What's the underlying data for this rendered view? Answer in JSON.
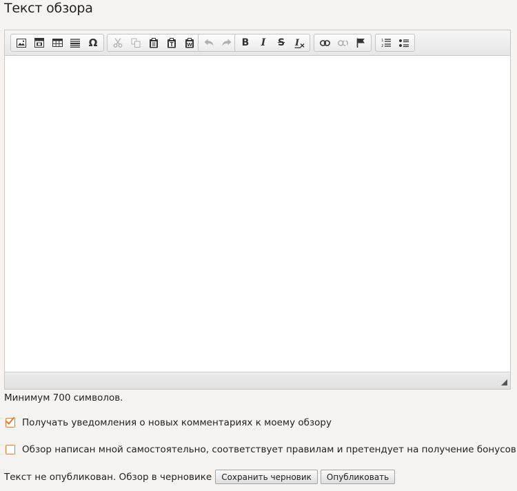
{
  "title": "Текст обзора",
  "toolbar": {
    "groups": [
      [
        "image-icon",
        "flash-icon",
        "table-icon",
        "horizontal-rule-icon",
        "special-char-icon"
      ],
      [
        "cut-icon",
        "copy-icon",
        "paste-icon",
        "paste-text-icon",
        "paste-word-icon"
      ],
      [
        "undo-icon",
        "redo-icon"
      ],
      [
        "bold-icon",
        "italic-icon",
        "strike-icon",
        "remove-format-icon"
      ],
      [
        "link-icon",
        "unlink-icon",
        "anchor-icon"
      ],
      [
        "numbered-list-icon",
        "bulleted-list-icon"
      ]
    ],
    "special_char_glyph": "Ω",
    "bold_glyph": "B",
    "italic_glyph": "I",
    "strike_glyph": "S"
  },
  "editor": {
    "content": ""
  },
  "hint": "Минимум 700 символов.",
  "checkbox_notify": {
    "label": "Получать уведомления о новых комментариях к моему обзору",
    "checked": true
  },
  "checkbox_own": {
    "label": "Обзор написан мной самостоятельно, соответствует правилам и претендует на получение бонусов",
    "checked": false
  },
  "status_text": "Текст не опубликован. Обзор в черновике",
  "buttons": {
    "save_draft": "Сохранить черновик",
    "publish": "Опубликовать"
  },
  "colors": {
    "accent": "#e27a2e",
    "background": "#f5f4f2"
  }
}
